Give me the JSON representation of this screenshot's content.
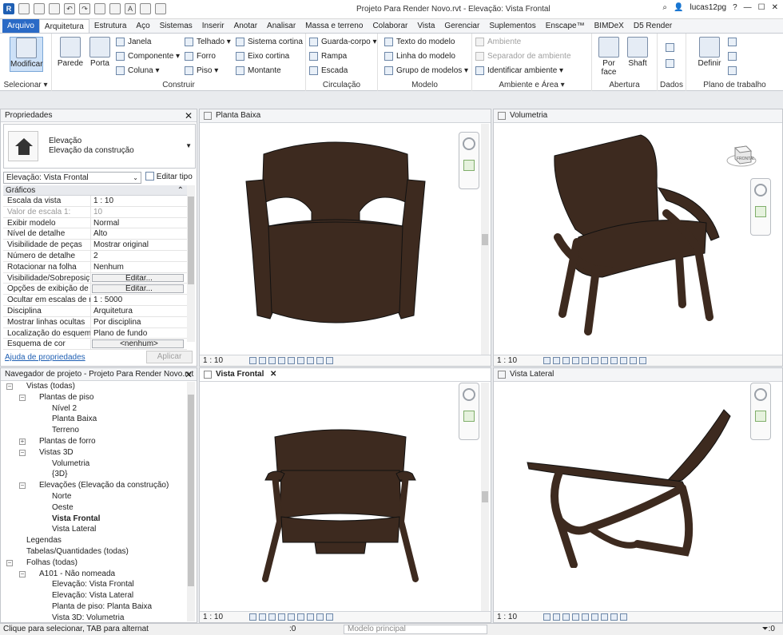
{
  "window": {
    "title": "Projeto Para Render Novo.rvt - Elevação: Vista Frontal",
    "user": "lucas12pg",
    "help_label": "?"
  },
  "ribbon_tabs": [
    "Arquivo",
    "Arquitetura",
    "Estrutura",
    "Aço",
    "Sistemas",
    "Inserir",
    "Anotar",
    "Analisar",
    "Massa e terreno",
    "Colaborar",
    "Vista",
    "Gerenciar",
    "Suplementos",
    "Enscape™",
    "BIMDeX",
    "D5 Render"
  ],
  "ribbon": {
    "select": {
      "modify": "Modificar",
      "group": "Selecionar ▾"
    },
    "build": {
      "parede": "Parede",
      "porta": "Porta",
      "janela": "Janela",
      "componente": "Componente ▾",
      "coluna": "Coluna ▾",
      "telhado": "Telhado ▾",
      "forro": "Forro",
      "piso": "Piso ▾",
      "sistema_cortina": "Sistema cortina",
      "eixo_cortina": "Eixo cortina",
      "montante": "Montante",
      "group": "Construir"
    },
    "circulation": {
      "guarda_corpo": "Guarda-corpo ▾",
      "rampa": "Rampa",
      "escada": "Escada",
      "group": "Circulação"
    },
    "model": {
      "texto": "Texto do modelo",
      "linha": "Linha do modelo",
      "grupo": "Grupo de modelos ▾",
      "group": "Modelo"
    },
    "room": {
      "ambiente": "Ambiente",
      "separador": "Separador de ambiente",
      "identificar": "Identificar ambiente ▾",
      "group": "Ambiente e Área ▾"
    },
    "opening": {
      "por_face": "Por\nface",
      "shaft": "Shaft",
      "group": "Abertura"
    },
    "datum": {
      "group": "Dados"
    },
    "workplane": {
      "definir": "Definir",
      "group": "Plano de trabalho"
    }
  },
  "properties": {
    "title": "Propriedades",
    "type_line1": "Elevação",
    "type_line2": "Elevação da construção",
    "view_selector": "Elevação: Vista Frontal",
    "edit_type": "Editar tipo",
    "section": "Gráficos",
    "rows": [
      {
        "name": "Escala da vista",
        "value": "1 : 10"
      },
      {
        "name": "Valor de escala    1:",
        "value": "10"
      },
      {
        "name": "Exibir modelo",
        "value": "Normal"
      },
      {
        "name": "Nível de detalhe",
        "value": "Alto"
      },
      {
        "name": "Visibilidade de peças",
        "value": "Mostrar original"
      },
      {
        "name": "Número de detalhe",
        "value": "2"
      },
      {
        "name": "Rotacionar na folha",
        "value": "Nenhum"
      },
      {
        "name": "Visibilidade/Sobreposiç...",
        "value": "Editar..."
      },
      {
        "name": "Opções de exibição de ...",
        "value": "Editar..."
      },
      {
        "name": "Ocultar em escalas de r...",
        "value": "1 : 5000"
      },
      {
        "name": "Disciplina",
        "value": "Arquitetura"
      },
      {
        "name": "Mostrar linhas ocultas",
        "value": "Por disciplina"
      },
      {
        "name": "Localização do esquem...",
        "value": "Plano de fundo"
      },
      {
        "name": "Esquema de cor",
        "value": "<nenhum>"
      }
    ],
    "help": "Ajuda de propriedades",
    "apply": "Aplicar"
  },
  "browser": {
    "title": "Navegador de projeto - Projeto Para Render Novo.rvt",
    "nodes": [
      {
        "label": "Vistas (todas)",
        "toggle": "−",
        "indent": 0
      },
      {
        "label": "Plantas de piso",
        "toggle": "−",
        "indent": 1
      },
      {
        "label": "Nível 2",
        "toggle": "",
        "indent": 2
      },
      {
        "label": "Planta Baixa",
        "toggle": "",
        "indent": 2
      },
      {
        "label": "Terreno",
        "toggle": "",
        "indent": 2
      },
      {
        "label": "Plantas de forro",
        "toggle": "+",
        "indent": 1
      },
      {
        "label": "Vistas 3D",
        "toggle": "−",
        "indent": 1
      },
      {
        "label": "Volumetria",
        "toggle": "",
        "indent": 2
      },
      {
        "label": "{3D}",
        "toggle": "",
        "indent": 2
      },
      {
        "label": "Elevações (Elevação da construção)",
        "toggle": "−",
        "indent": 1
      },
      {
        "label": "Norte",
        "toggle": "",
        "indent": 2
      },
      {
        "label": "Oeste",
        "toggle": "",
        "indent": 2
      },
      {
        "label": "Vista Frontal",
        "toggle": "",
        "indent": 2,
        "bold": true
      },
      {
        "label": "Vista Lateral",
        "toggle": "",
        "indent": 2
      },
      {
        "label": "Legendas",
        "toggle": "",
        "indent": 0
      },
      {
        "label": "Tabelas/Quantidades (todas)",
        "toggle": "",
        "indent": 0
      },
      {
        "label": "Folhas (todas)",
        "toggle": "−",
        "indent": 0
      },
      {
        "label": "A101 - Não nomeada",
        "toggle": "−",
        "indent": 1
      },
      {
        "label": "Elevação: Vista Frontal",
        "toggle": "",
        "indent": 2
      },
      {
        "label": "Elevação: Vista Lateral",
        "toggle": "",
        "indent": 2
      },
      {
        "label": "Planta de piso: Planta Baixa",
        "toggle": "",
        "indent": 2
      },
      {
        "label": "Vista 3D: Volumetria",
        "toggle": "",
        "indent": 2
      }
    ]
  },
  "views": {
    "planta": {
      "title": "Planta Baixa",
      "scale": "1 : 10"
    },
    "volumetria": {
      "title": "Volumetria",
      "scale": "1 : 10",
      "cube_label": "FRONTAL"
    },
    "frontal": {
      "title": "Vista Frontal",
      "scale": "1 : 10"
    },
    "lateral": {
      "title": "Vista Lateral",
      "scale": "1 : 10"
    }
  },
  "status": {
    "text": "Clique para selecionar, TAB para alternat",
    "zero": ":0",
    "model": "Modelo principal",
    "filter": ":0"
  },
  "colors": {
    "chair": "#3d2a1f",
    "accent": "#2a6ac6"
  }
}
